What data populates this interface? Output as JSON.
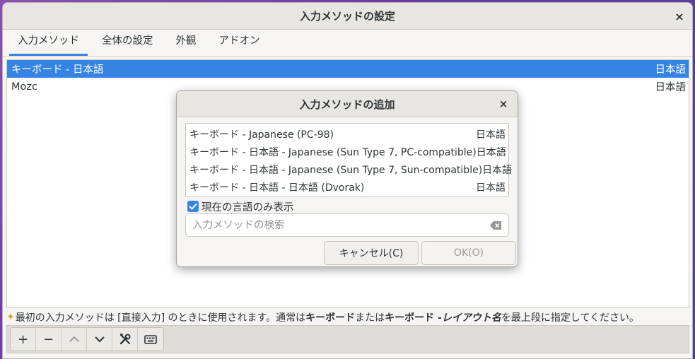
{
  "window": {
    "title": "入力メソッドの設定",
    "close_glyph": "×"
  },
  "tabs": [
    {
      "label": "入力メソッド",
      "active": true
    },
    {
      "label": "全体の設定",
      "active": false
    },
    {
      "label": "外観",
      "active": false
    },
    {
      "label": "アドオン",
      "active": false
    }
  ],
  "input_methods": [
    {
      "name": "キーボード - 日本語",
      "lang": "日本語",
      "selected": true
    },
    {
      "name": "Mozc",
      "lang": "日本語",
      "selected": false
    }
  ],
  "hint": {
    "part1": "最初の入力メソッドは [直接入力] のときに使用されます。通常は ",
    "bold1": "キーボード",
    "part2": " または ",
    "bold2": "キーボード - ",
    "italic": "レイアウト名",
    "part3": " を最上段に指定してください。"
  },
  "toolbar": {
    "add": "+",
    "remove": "−",
    "up": "up-chevron",
    "down": "down-chevron",
    "configure": "tools-icon",
    "keyboard": "keyboard-icon"
  },
  "dialog": {
    "title": "入力メソッドの追加",
    "close_glyph": "×",
    "items": [
      {
        "name": "キーボード - Japanese (PC-98)",
        "lang": "日本語"
      },
      {
        "name": "キーボード - 日本語 - Japanese (Sun Type 7, PC-compatible)",
        "lang": "日本語"
      },
      {
        "name": "キーボード - 日本語 - Japanese (Sun Type 7, Sun-compatible)",
        "lang": "日本語"
      },
      {
        "name": "キーボード - 日本語 - 日本語 (Dvorak)",
        "lang": "日本語"
      }
    ],
    "only_current_language": {
      "label": "現在の言語のみ表示",
      "checked": true
    },
    "search": {
      "value": "",
      "placeholder": "入力メソッドの検索"
    },
    "cancel_label": "キャンセル(C)",
    "ok_label": "OK(O)"
  },
  "colors": {
    "accent": "#3584e4",
    "star": "#d4a017"
  }
}
